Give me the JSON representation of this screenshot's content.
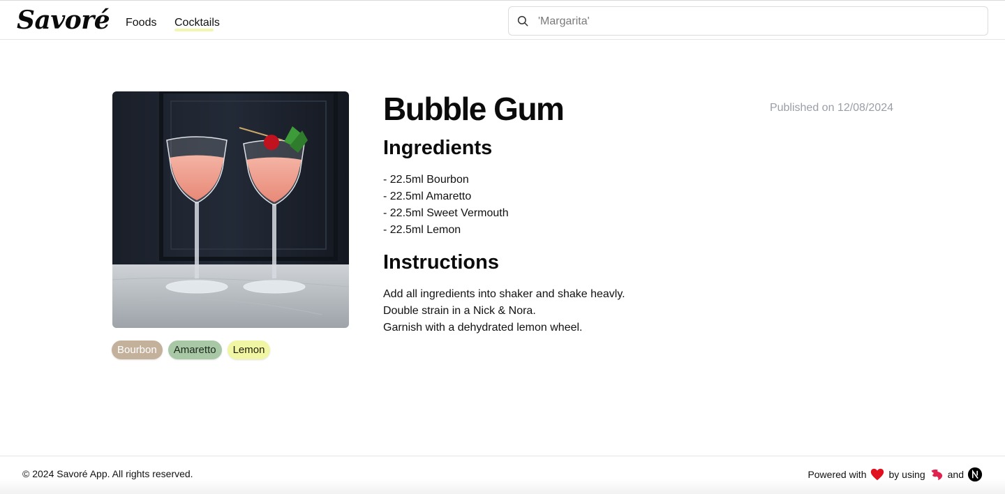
{
  "header": {
    "logo": "Savoré",
    "nav": {
      "foods": "Foods",
      "cocktails": "Cocktails"
    },
    "search": {
      "placeholder": "'Margarita'",
      "value": ""
    }
  },
  "recipe": {
    "title": "Bubble Gum",
    "published": "Published on 12/08/2024",
    "image_alt": "Two pink cocktails in Nick & Nora glasses garnished with a cherry and mint",
    "tags": [
      {
        "label": "Bourbon",
        "color": "#c4b19b"
      },
      {
        "label": "Amaretto",
        "color": "#a9c8a6"
      },
      {
        "label": "Lemon",
        "color": "#f0f6a3"
      }
    ],
    "ingredients_heading": "Ingredients",
    "ingredients": [
      "- 22.5ml Bourbon",
      "- 22.5ml Amaretto",
      "- 22.5ml Sweet Vermouth",
      "- 22.5ml Lemon"
    ],
    "instructions_heading": "Instructions",
    "instructions": [
      "Add all ingredients into shaker and shake heavly.",
      "Double strain in a Nick & Nora.",
      "Garnish with a dehydrated lemon wheel."
    ]
  },
  "footer": {
    "copyright": "© 2024 Savoré App. All rights reserved.",
    "powered_prefix": "Powered with",
    "by_using": "by using",
    "and": "and",
    "icons": [
      "heart-icon",
      "nestjs-icon",
      "nextjs-icon"
    ]
  },
  "colors": {
    "accent_underline": "#f2f7b0",
    "muted_text": "#999ea6",
    "heart": "#e0101e",
    "nest": "#e0234e"
  }
}
